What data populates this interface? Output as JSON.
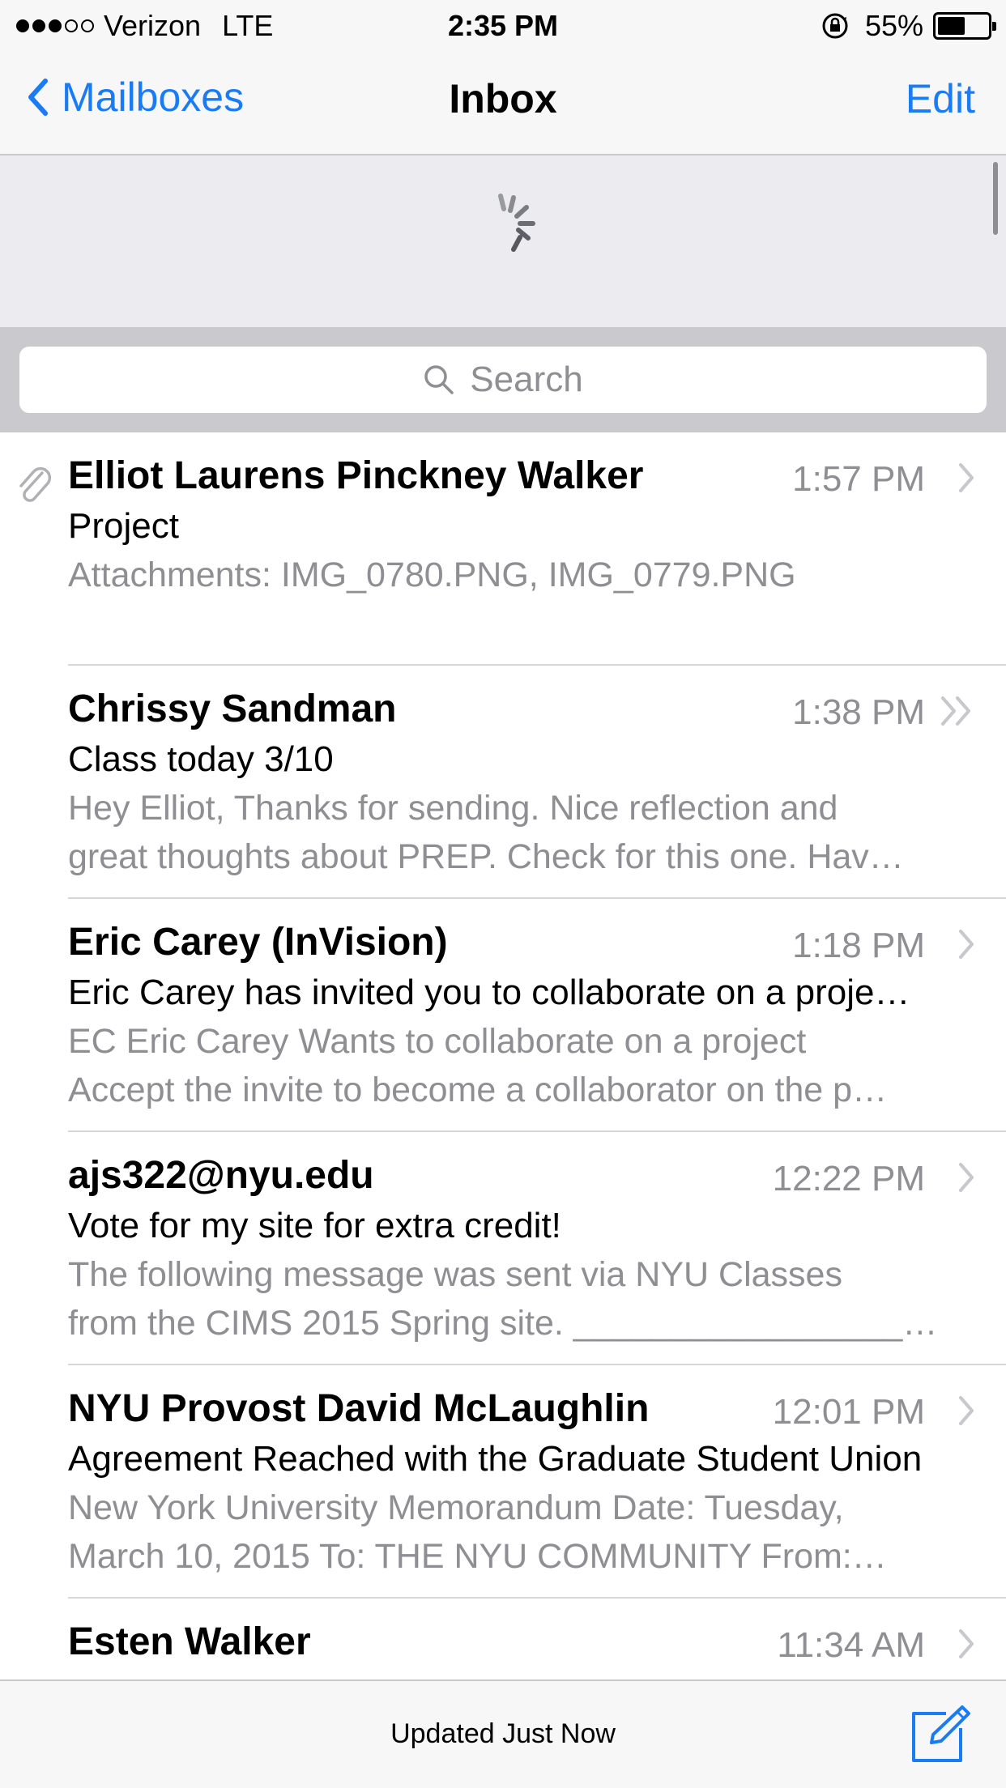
{
  "status_bar": {
    "carrier": "Verizon",
    "network": "LTE",
    "time": "2:35 PM",
    "battery_percent": "55%",
    "battery_level": 0.55,
    "signal_bars_filled": 3,
    "signal_bars_total": 5
  },
  "nav": {
    "back_label": "Mailboxes",
    "title": "Inbox",
    "edit_label": "Edit"
  },
  "search": {
    "placeholder": "Search"
  },
  "messages": [
    {
      "sender": "Elliot Laurens Pinckney Walker",
      "time": "1:57 PM",
      "subject": "Project",
      "preview_line1": "Attachments: IMG_0780.PNG, IMG_0779.PNG",
      "preview_line2": "",
      "has_attachment": true,
      "chevron": "single"
    },
    {
      "sender": "Chrissy Sandman",
      "time": "1:38 PM",
      "subject": "Class today 3/10",
      "preview_line1": "Hey Elliot, Thanks for sending. Nice reflection and",
      "preview_line2": "great thoughts about PREP. Check for this one. Hav…",
      "has_attachment": false,
      "chevron": "double"
    },
    {
      "sender": "Eric Carey (InVision)",
      "time": "1:18 PM",
      "subject": "Eric Carey has invited you to collaborate on a proje…",
      "preview_line1": "EC Eric Carey Wants to collaborate on a project",
      "preview_line2": "Accept the invite to become a collaborator on the p…",
      "has_attachment": false,
      "chevron": "single"
    },
    {
      "sender": "ajs322@nyu.edu",
      "time": "12:22 PM",
      "subject": "Vote for my site for extra credit!",
      "preview_line1": "The following message was sent via NYU Classes",
      "preview_line2": "from the CIMS 2015 Spring site. _________________…",
      "has_attachment": false,
      "chevron": "single"
    },
    {
      "sender": "NYU Provost David McLaughlin",
      "time": "12:01 PM",
      "subject": "Agreement Reached with the Graduate Student Union",
      "preview_line1": "New York University Memorandum Date: Tuesday,",
      "preview_line2": "March 10, 2015 To: THE NYU COMMUNITY From:…",
      "has_attachment": false,
      "chevron": "single"
    },
    {
      "sender": "Esten Walker",
      "time": "11:34 AM",
      "subject": "",
      "preview_line1": "",
      "preview_line2": "",
      "has_attachment": false,
      "chevron": "single"
    }
  ],
  "toolbar": {
    "status": "Updated Just Now"
  },
  "colors": {
    "accent": "#1a7cf4",
    "secondary_text": "#8e8e93"
  }
}
